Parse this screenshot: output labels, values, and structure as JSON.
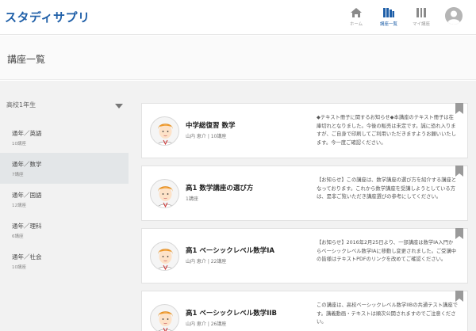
{
  "header": {
    "logo": "スタディサプリ",
    "nav": [
      {
        "label": "ホーム",
        "icon": "home-icon"
      },
      {
        "label": "講座一覧",
        "icon": "course-list-icon"
      },
      {
        "label": "マイ講座",
        "icon": "my-course-icon"
      }
    ],
    "avatar_icon": "user-avatar-icon"
  },
  "page": {
    "title": "講座一覧"
  },
  "sidebar": {
    "grade": "高校1年生",
    "items": [
      {
        "name": "通年／英語",
        "count": "10講座"
      },
      {
        "name": "通年／数学",
        "count": "7講座"
      },
      {
        "name": "通年／国語",
        "count": "12講座"
      },
      {
        "name": "通年／理科",
        "count": "6講座"
      },
      {
        "name": "通年／社会",
        "count": "10講座"
      }
    ]
  },
  "courses": [
    {
      "title": "中学総復習 数学",
      "meta": "山内 恵介 | 10講座",
      "desc": "◆テキスト冊子に関するお知らせ◆本講座のテキスト冊子は在庫切れとなりました。今後の販売は未定です。誠に恐れ入りますが、ご自身で印刷してご利用いただきますようお願いいたします。今一度ご確認ください。"
    },
    {
      "title": "高1 数学講座の選び方",
      "meta": "1講座",
      "desc": "【お知らせ】この講座は、数学講座の選び方を紹介する講座となっております。これから数学講座を受講しようとしている方は、是非ご覧いただき講座選びの参考にしてください。"
    },
    {
      "title": "高1 ベーシックレベル数学IA",
      "meta": "山内 恵介 | 22講座",
      "desc": "【お知らせ】2016年2月25日より、一部講座は数学IA入門からベーシックレベル数学IAに移動し変更されました。ご受講中の皆様はテキストPDFのリンクを改めてご確認ください。"
    },
    {
      "title": "高1 ベーシックレベル数学IIB",
      "meta": "山内 恵介 | 26講座",
      "desc": "この講座は、高校ベーシックレベル数学IIBの共通テスト講座です。講義動画・テキストは順次公開されますのでご注意ください。"
    }
  ],
  "colors": {
    "brand": "#1f5fa8",
    "bookmark": "#9a9a9a"
  }
}
